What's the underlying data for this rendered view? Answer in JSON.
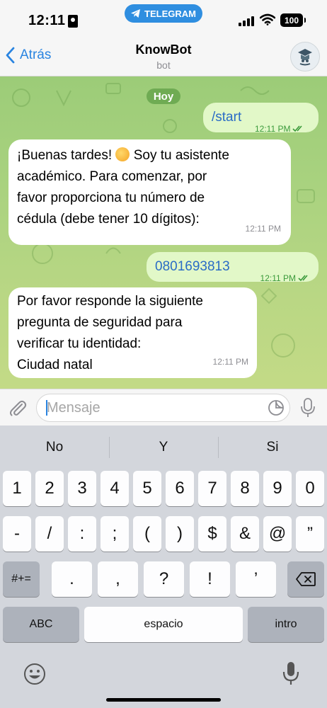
{
  "status_bar": {
    "time": "12:11",
    "app_pill": "TELEGRAM",
    "battery": "100"
  },
  "header": {
    "back_label": "Atrás",
    "title": "KnowBot",
    "subtitle": "bot"
  },
  "chat": {
    "date_label": "Hoy",
    "messages": [
      {
        "direction": "out",
        "text": "/start",
        "time": "12:11 PM",
        "status": "read"
      },
      {
        "direction": "in",
        "lines": [
          "¡Buenas tardes! ",
          " Soy tu asistente",
          "académico. Para comenzar, por",
          "favor proporciona tu número de",
          "cédula (debe tener 10 dígitos):"
        ],
        "time": "12:11 PM"
      },
      {
        "direction": "out",
        "text": "0801693813",
        "time": "12:11 PM",
        "status": "read"
      },
      {
        "direction": "in",
        "lines": [
          "Por favor responde la siguiente",
          "pregunta de seguridad para",
          "verificar tu identidad:",
          "Ciudad natal"
        ],
        "time": "12:11 PM"
      }
    ]
  },
  "composer": {
    "placeholder": "Mensaje",
    "value": ""
  },
  "keyboard": {
    "suggestions": [
      "No",
      "Y",
      "Si"
    ],
    "row1": [
      "1",
      "2",
      "3",
      "4",
      "5",
      "6",
      "7",
      "8",
      "9",
      "0"
    ],
    "row2": [
      "-",
      "/",
      ":",
      ";",
      "(",
      ")",
      "$",
      "&",
      "@",
      "”"
    ],
    "row3": [
      ".",
      ",",
      "?",
      "!",
      "’"
    ],
    "symbols_key": "#+=",
    "abc_key": "ABC",
    "space_key": "espacio",
    "return_key": "intro"
  },
  "colors": {
    "accent": "#2a84e0",
    "telegram_pill": "#2f8ee0",
    "outgoing_bubble": "#e2f8c8",
    "incoming_bubble": "#ffffff",
    "read_check": "#3a9a3a"
  },
  "icons": [
    "lock-icon",
    "telegram-icon",
    "signal-icon",
    "wifi-icon",
    "battery-icon",
    "chevron-left-icon",
    "bot-avatar-icon",
    "double-check-icon",
    "sun-emoji-icon",
    "paperclip-icon",
    "sticker-icon",
    "microphone-icon",
    "backspace-icon",
    "emoji-icon"
  ]
}
